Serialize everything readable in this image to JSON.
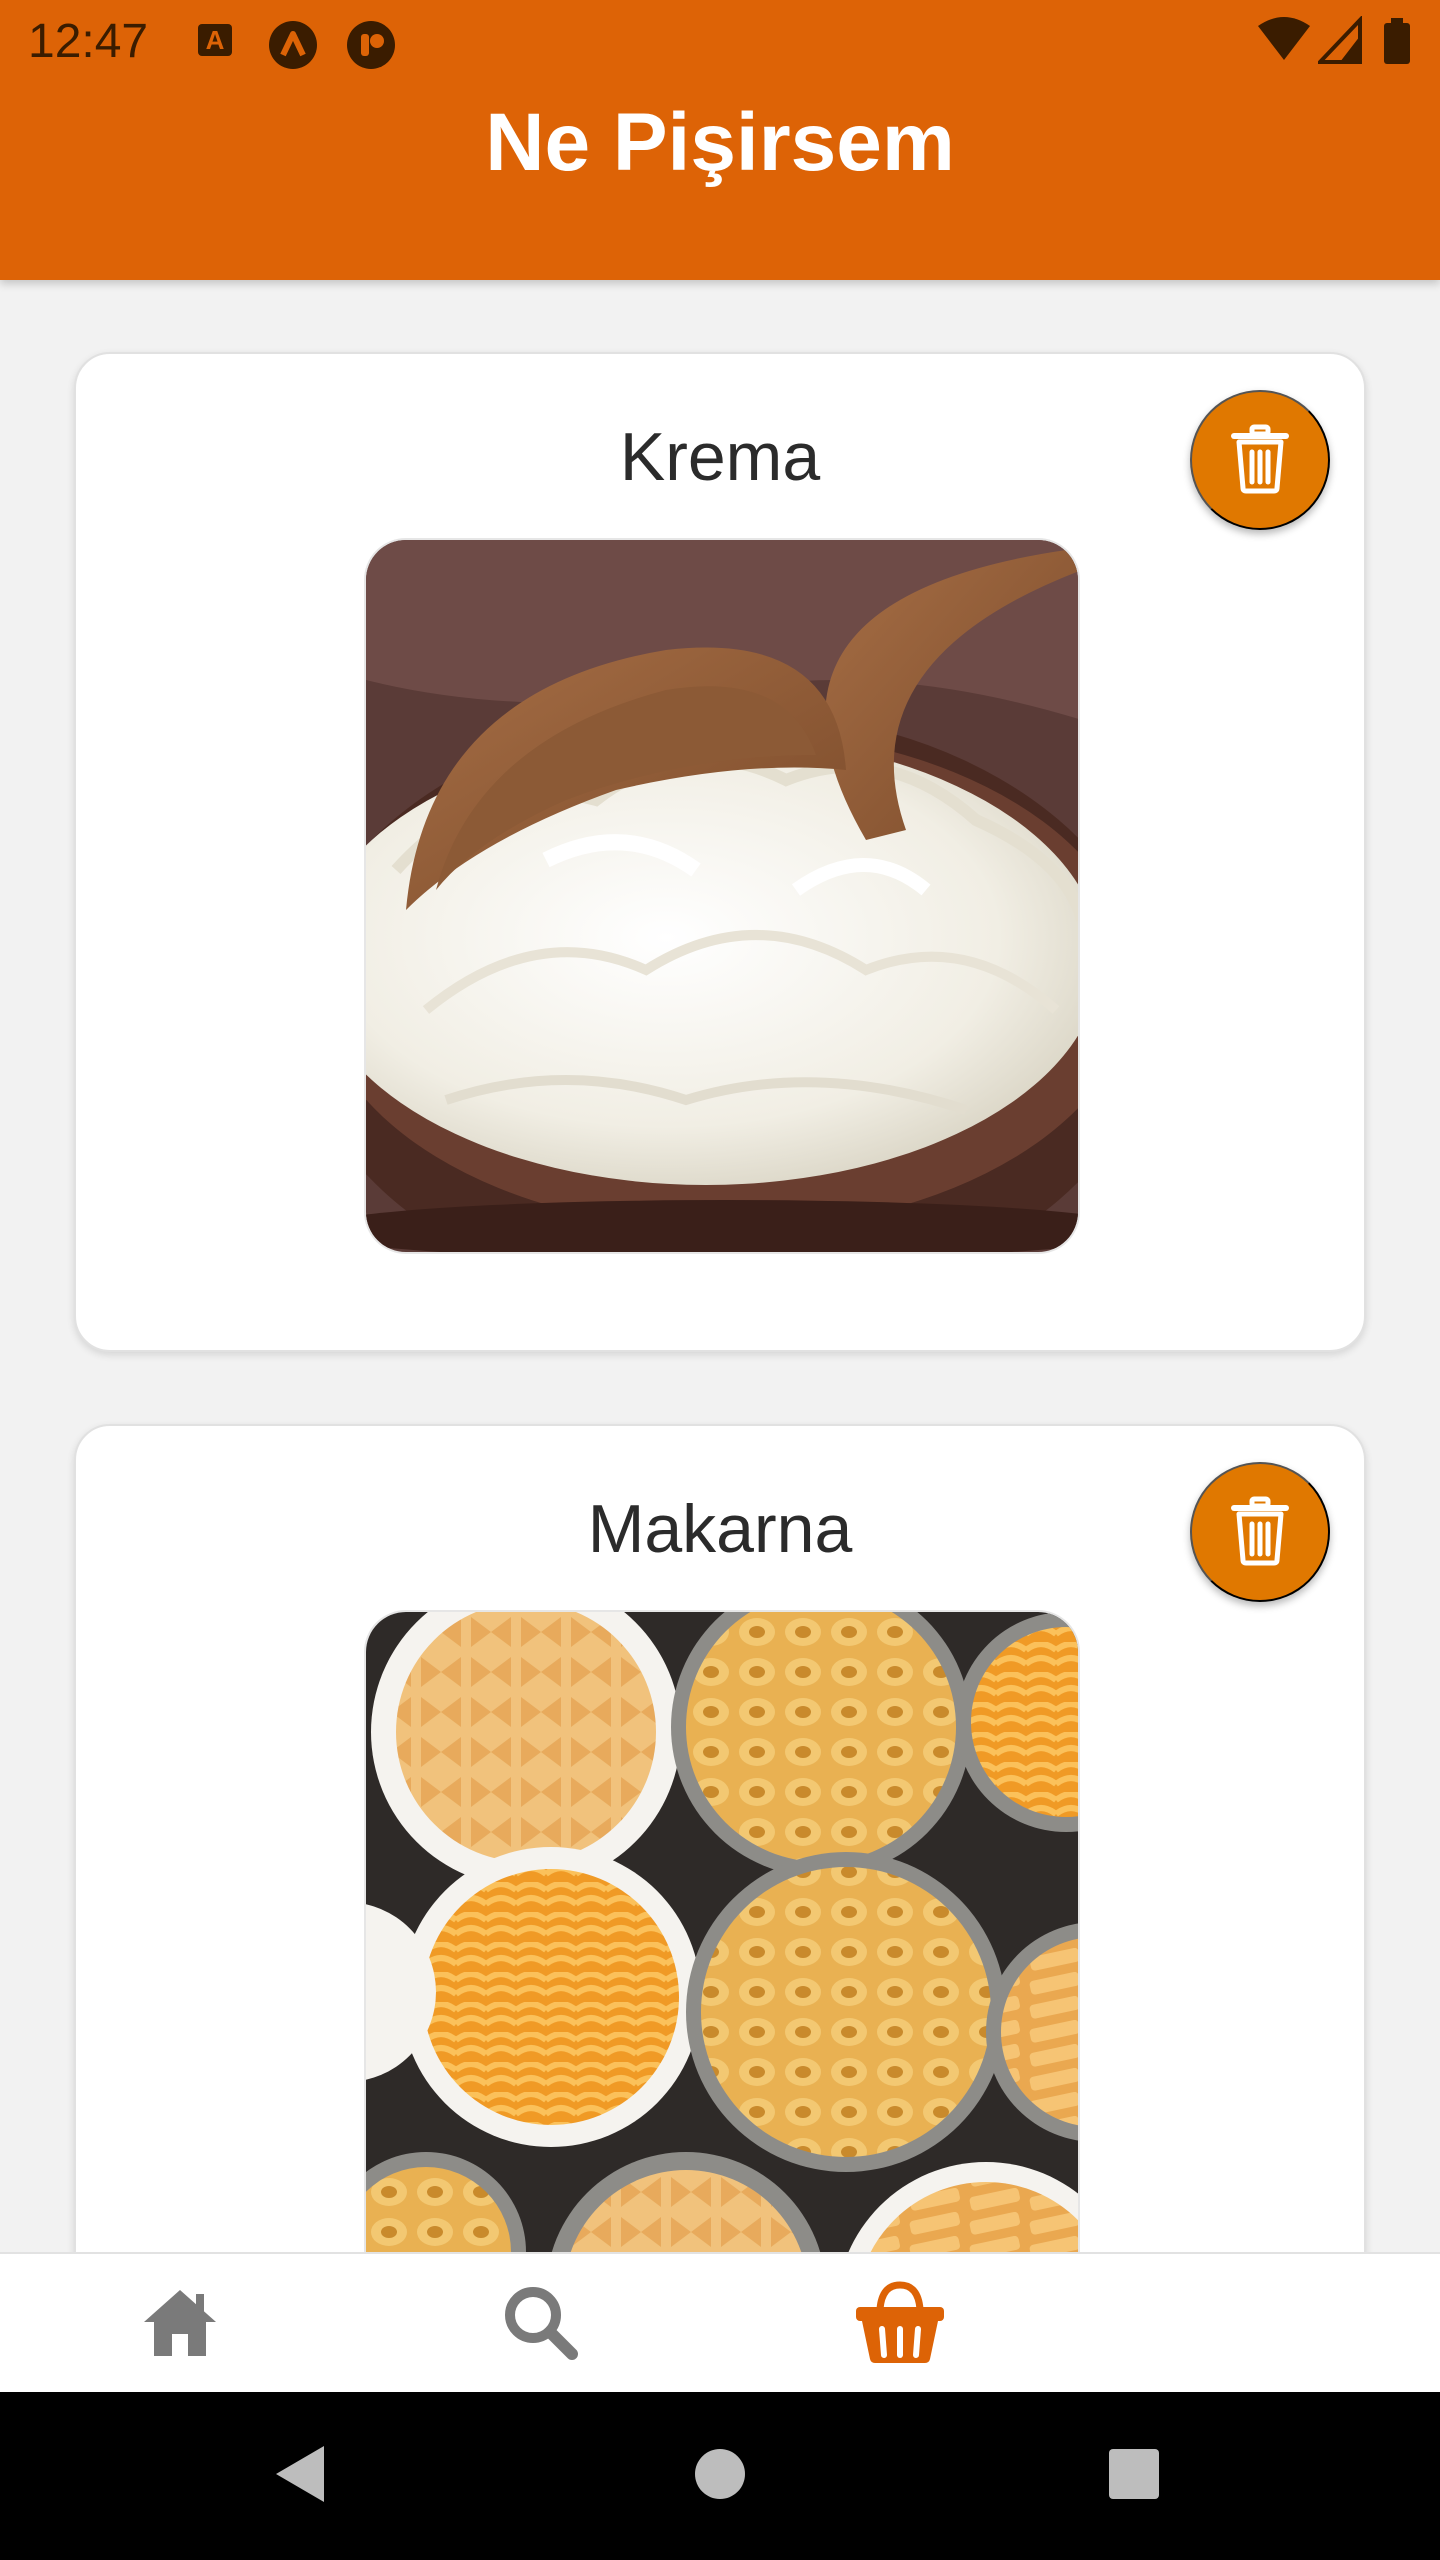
{
  "status_bar": {
    "time": "12:47",
    "left_icons": [
      "app-a-icon",
      "app-lambda-icon",
      "app-circle-icon"
    ],
    "right_icons": [
      "wifi-icon",
      "cell-signal-icon",
      "battery-icon"
    ]
  },
  "header": {
    "title": "Ne Pişirsem",
    "background_color": "#dd6306"
  },
  "ingredients": [
    {
      "name": "Krema",
      "image": "cream-in-bowl-image",
      "delete_icon": "trash-icon"
    },
    {
      "name": "Makarna",
      "image": "assorted-pasta-bowls-image",
      "delete_icon": "trash-icon"
    }
  ],
  "bottom_nav": {
    "items": [
      {
        "icon": "home-icon",
        "active": false
      },
      {
        "icon": "search-icon",
        "active": false
      },
      {
        "icon": "basket-icon",
        "active": true
      }
    ],
    "active_color": "#dd6306",
    "inactive_color": "#7a7a7a"
  },
  "system_nav": {
    "buttons": [
      "back-icon",
      "home-circle-icon",
      "recents-square-icon"
    ]
  },
  "colors": {
    "accent": "#e07800",
    "header": "#dd6306"
  }
}
